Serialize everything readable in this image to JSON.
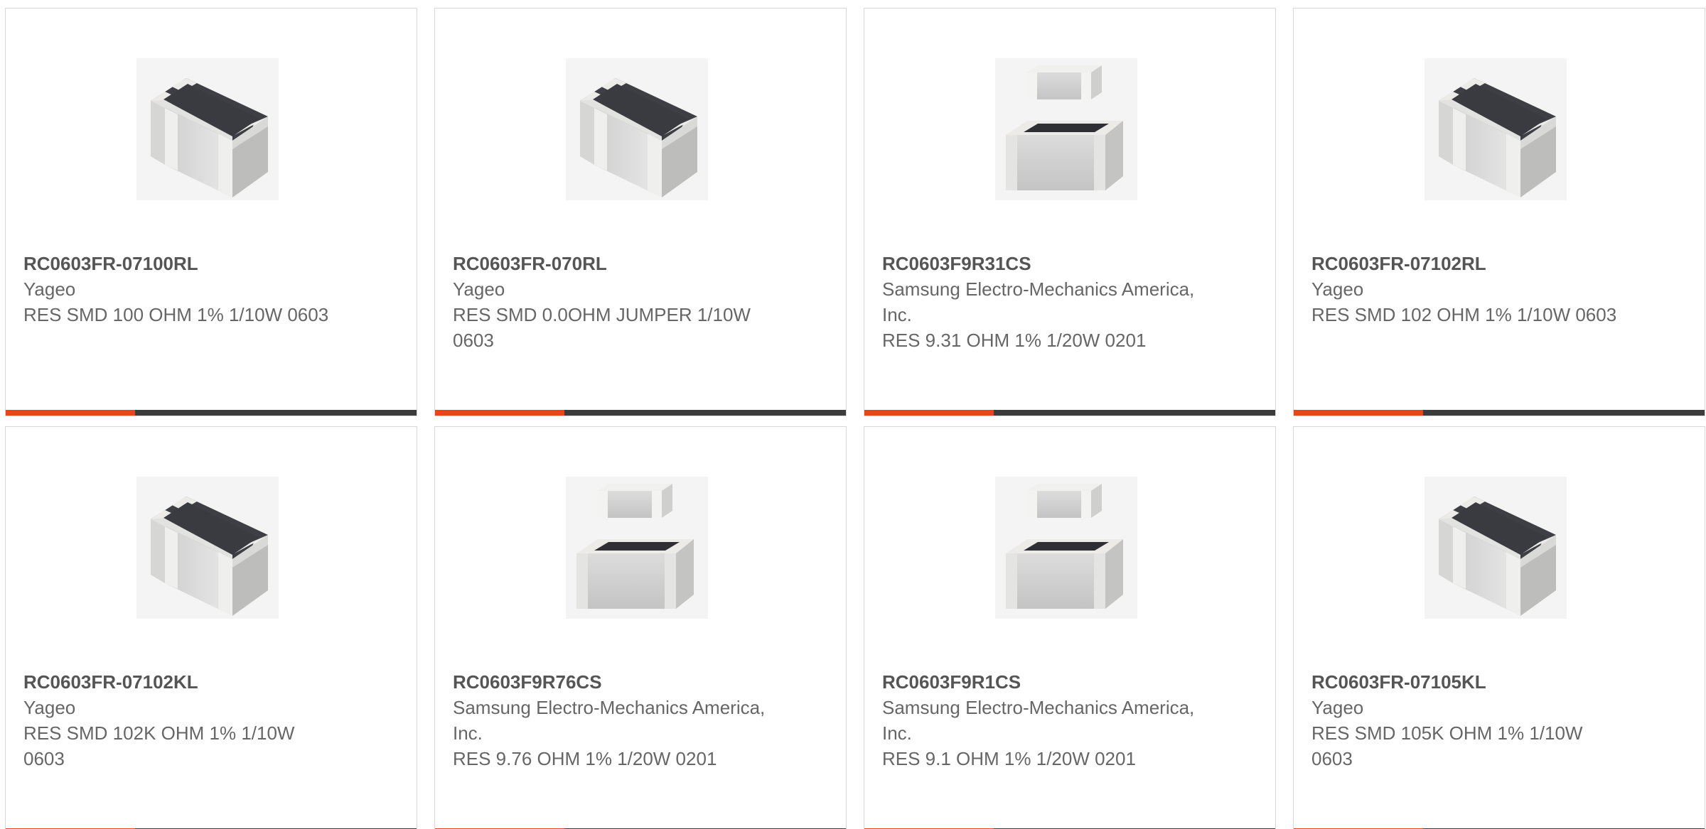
{
  "colors": {
    "accent": "#e8451c",
    "bar": "#3b3b3b",
    "border": "#d8d8d8",
    "text": "#666666"
  },
  "products": [
    {
      "part": "RC0603FR-07100RL",
      "manufacturer": "Yageo",
      "description": "RES SMD 100 OHM 1% 1/10W 0603",
      "image": "resistor-chip-icon"
    },
    {
      "part": "RC0603FR-070RL",
      "manufacturer": "Yageo",
      "description": "RES SMD 0.0OHM JUMPER 1/10W 0603",
      "image": "resistor-chip-icon"
    },
    {
      "part": "RC0603F9R31CS",
      "manufacturer": "Samsung Electro-Mechanics America, Inc.",
      "description": "RES 9.31 OHM 1% 1/20W 0201",
      "image": "resistor-pair-icon"
    },
    {
      "part": "RC0603FR-07102RL",
      "manufacturer": "Yageo",
      "description": "RES SMD 102 OHM 1% 1/10W 0603",
      "image": "resistor-chip-icon"
    },
    {
      "part": "RC0603FR-07102KL",
      "manufacturer": "Yageo",
      "description": "RES SMD 102K OHM 1% 1/10W 0603",
      "image": "resistor-chip-icon"
    },
    {
      "part": "RC0603F9R76CS",
      "manufacturer": "Samsung Electro-Mechanics America, Inc.",
      "description": "RES 9.76 OHM 1% 1/20W 0201",
      "image": "resistor-pair-icon"
    },
    {
      "part": "RC0603F9R1CS",
      "manufacturer": "Samsung Electro-Mechanics America, Inc.",
      "description": "RES 9.1 OHM 1% 1/20W 0201",
      "image": "resistor-pair-icon"
    },
    {
      "part": "RC0603FR-07105KL",
      "manufacturer": "Yageo",
      "description": "RES SMD 105K OHM 1% 1/10W 0603",
      "image": "resistor-chip-icon"
    }
  ]
}
